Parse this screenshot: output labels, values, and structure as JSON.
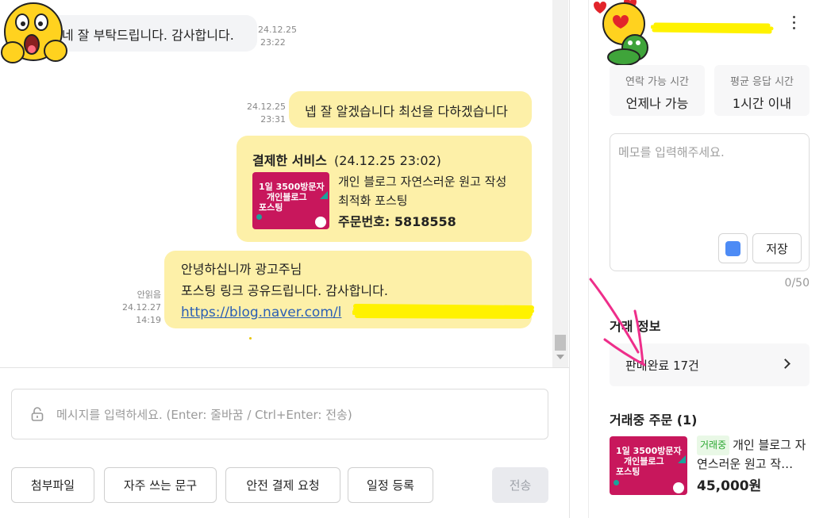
{
  "chat": {
    "messages": [
      {
        "side": "in",
        "text": "네 잘 부탁드립니다. 감사합니다.",
        "date": "24.12.25",
        "time": "23:22"
      },
      {
        "side": "out",
        "text": "넵 잘 알겠습니다 최선을 다하겠습니다",
        "date": "24.12.25",
        "time": "23:31"
      }
    ],
    "payment_card": {
      "title": "결제한 서비스",
      "datetime": "(24.12.25 23:02)",
      "service_name_line1": "개인 블로그 자연스러운 원고 작성",
      "service_name_line2": "최적화 포스팅",
      "order_number": "주문번호: 5818558",
      "thumb_text_1": "1일 3500방문자",
      "thumb_text_2": "개인블로그",
      "thumb_text_3": "포스팅"
    },
    "last_message": {
      "line1": "안녕하십니까 광고주님",
      "line2": "포스팅 링크 공유드립니다. 감사합니다.",
      "link": "https://blog.naver.com/l",
      "read_status": "안읽음",
      "date": "24.12.27",
      "time": "14:19"
    }
  },
  "composer": {
    "placeholder": "메시지를 입력하세요. (Enter: 줄바꿈 / Ctrl+Enter: 전송)",
    "buttons": {
      "attach": "첨부파일",
      "frequent": "자주 쓰는 문구",
      "safe_payment": "안전 결제 요청",
      "schedule": "일정 등록",
      "send": "전송"
    }
  },
  "profile": {
    "contact_label": "연락 가능 시간",
    "contact_value": "언제나 가능",
    "response_label": "평균 응답 시간",
    "response_value": "1시간 이내"
  },
  "memo": {
    "placeholder": "메모를 입력해주세요.",
    "save_label": "저장",
    "count": "0/50",
    "color": "#4d8bf5"
  },
  "trade": {
    "section_title": "거래 정보",
    "sales_completed": "판매완료 17건",
    "ongoing_title": "거래중 주문 (1)",
    "order_badge": "거래중",
    "order_title": "개인 블로그 자연스러운 원고 작…",
    "order_price": "45,000원"
  },
  "colors": {
    "outgoing_bubble": "#fdf0a8",
    "incoming_bubble": "#f3f4f6",
    "link": "#2b5fb4",
    "thumbnail": "#c8175c",
    "annotation": "#ee2e8a"
  }
}
